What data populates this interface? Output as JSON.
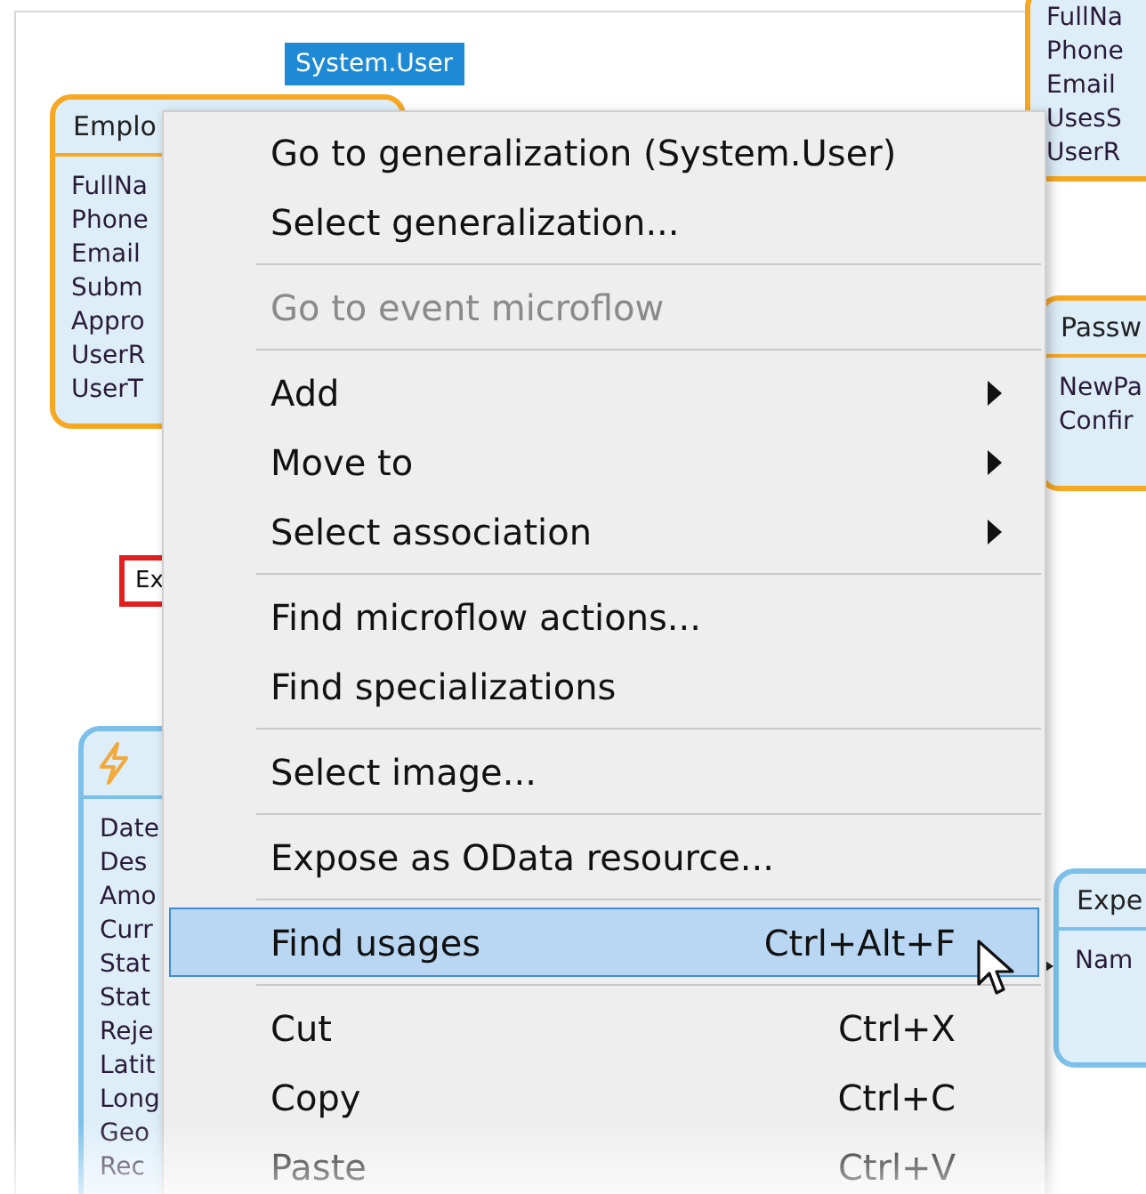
{
  "canvas": {
    "generalization_label": "System.User",
    "entities": [
      {
        "kind": "plain",
        "name": "Emplo",
        "color": "#f7a823",
        "attributes": [
          "FullNa",
          "Phone",
          "Email",
          "Subm",
          "Appro",
          "UserR",
          "UserT"
        ]
      },
      {
        "kind": "event",
        "color": "#7cc0ea",
        "attributes": [
          "Date",
          "Des",
          "Amo",
          "Curr",
          "Stat",
          "Stat",
          "Reje",
          "Latit",
          "Long",
          "Geo",
          "Rec"
        ]
      },
      {
        "kind": "headless",
        "color": "#f7a823",
        "attributes": [
          "FullNa",
          "Phone",
          "Email",
          "UsesS",
          "UserR"
        ]
      },
      {
        "kind": "plain",
        "name": "Passw",
        "color": "#f7a823",
        "attributes": [
          "NewPa",
          "Confir"
        ]
      },
      {
        "kind": "plain",
        "name": "Expe",
        "color": "#7cc0ea",
        "attributes": [
          "Nam"
        ]
      }
    ],
    "error_box": {
      "label": "Ex"
    }
  },
  "context_menu": {
    "items": [
      {
        "kind": "item",
        "label": "Go to generalization (System.User)",
        "disabled": false,
        "selected": false,
        "submenu": false
      },
      {
        "kind": "item",
        "label": "Select generalization...",
        "disabled": false,
        "selected": false,
        "submenu": false
      },
      {
        "kind": "separator"
      },
      {
        "kind": "item",
        "label": "Go to event microflow",
        "disabled": true,
        "selected": false,
        "submenu": false
      },
      {
        "kind": "separator"
      },
      {
        "kind": "item",
        "label": "Add",
        "disabled": false,
        "selected": false,
        "submenu": true
      },
      {
        "kind": "item",
        "label": "Move to",
        "disabled": false,
        "selected": false,
        "submenu": true
      },
      {
        "kind": "item",
        "label": "Select association",
        "disabled": false,
        "selected": false,
        "submenu": true
      },
      {
        "kind": "separator"
      },
      {
        "kind": "item",
        "label": "Find microflow actions...",
        "disabled": false,
        "selected": false,
        "submenu": false
      },
      {
        "kind": "item",
        "label": "Find specializations",
        "disabled": false,
        "selected": false,
        "submenu": false
      },
      {
        "kind": "separator"
      },
      {
        "kind": "item",
        "label": "Select image...",
        "disabled": false,
        "selected": false,
        "submenu": false
      },
      {
        "kind": "separator"
      },
      {
        "kind": "item",
        "label": "Expose as OData resource...",
        "disabled": false,
        "selected": false,
        "submenu": false
      },
      {
        "kind": "separator"
      },
      {
        "kind": "item",
        "label": "Find usages",
        "shortcut": "Ctrl+Alt+F",
        "disabled": false,
        "selected": true,
        "submenu": false
      },
      {
        "kind": "separator"
      },
      {
        "kind": "item",
        "label": "Cut",
        "shortcut": "Ctrl+X",
        "disabled": false,
        "selected": false,
        "submenu": false
      },
      {
        "kind": "item",
        "label": "Copy",
        "shortcut": "Ctrl+C",
        "disabled": false,
        "selected": false,
        "submenu": false
      },
      {
        "kind": "item",
        "label": "Paste",
        "shortcut": "Ctrl+V",
        "disabled": false,
        "selected": false,
        "submenu": false
      }
    ]
  }
}
